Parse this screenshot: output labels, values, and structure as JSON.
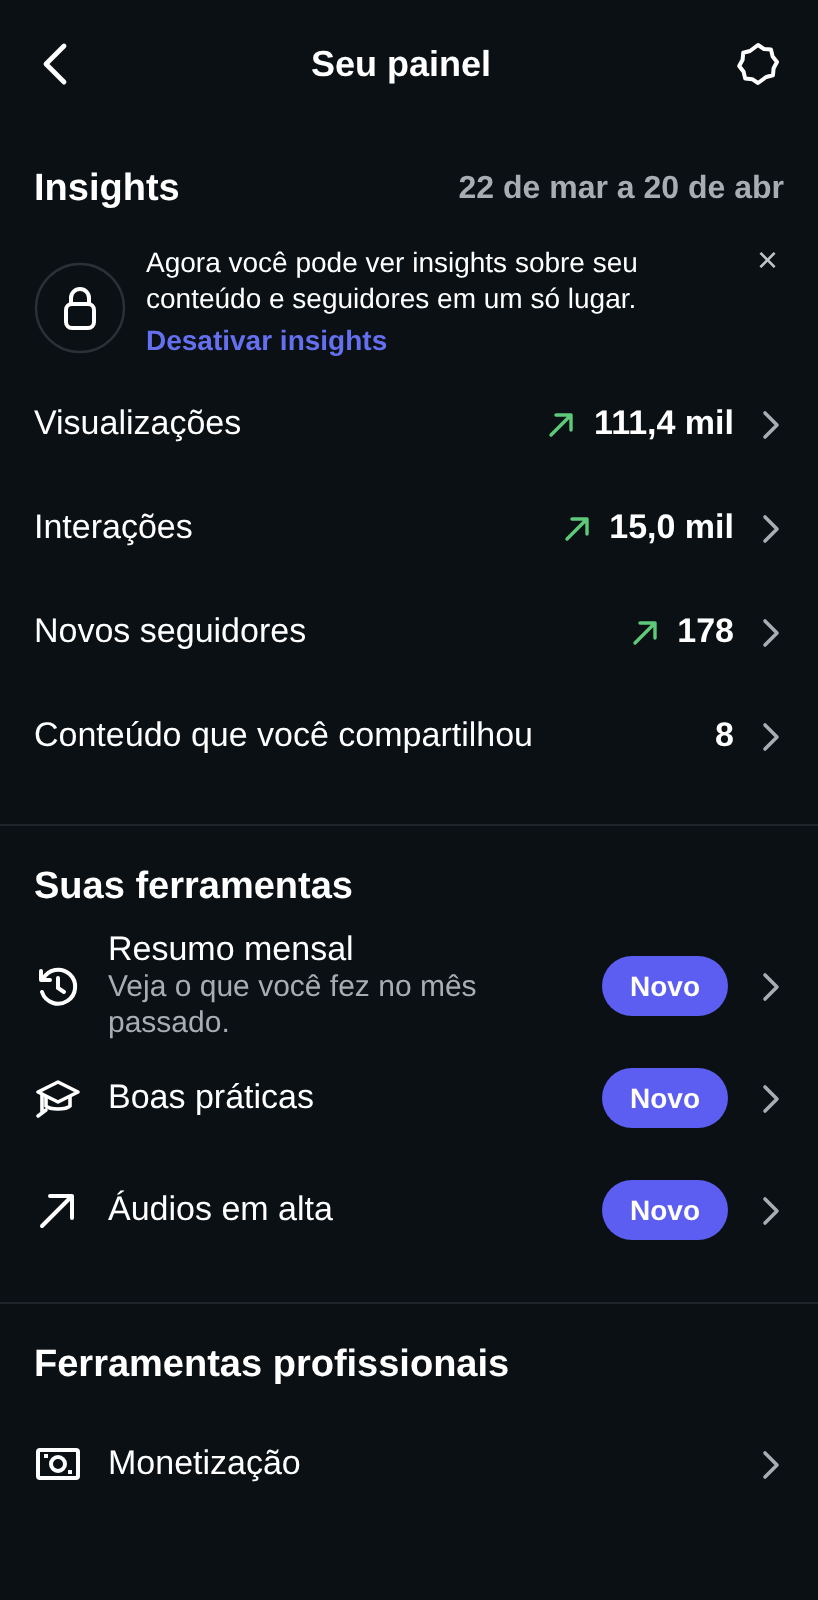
{
  "header": {
    "title": "Seu painel"
  },
  "insights": {
    "title": "Insights",
    "date_range": "22 de mar a 20 de abr",
    "banner": {
      "text": "Agora você pode ver insights sobre seu conteúdo e seguidores em um só lugar.",
      "link": "Desativar insights",
      "close": "×"
    },
    "metrics": [
      {
        "label": "Visualizações",
        "value": "111,4 mil",
        "trending": true
      },
      {
        "label": "Interações",
        "value": "15,0 mil",
        "trending": true
      },
      {
        "label": "Novos seguidores",
        "value": "178",
        "trending": true
      },
      {
        "label": "Conteúdo que você compartilhou",
        "value": "8",
        "trending": false
      }
    ]
  },
  "tools": {
    "title": "Suas ferramentas",
    "items": [
      {
        "kind": "history",
        "label": "Resumo mensal",
        "subtitle": "Veja o que você fez no mês passado.",
        "badge": "Novo"
      },
      {
        "kind": "cap",
        "label": "Boas práticas",
        "badge": "Novo"
      },
      {
        "kind": "trend",
        "label": "Áudios em alta",
        "badge": "Novo"
      }
    ]
  },
  "pro_tools": {
    "title": "Ferramentas profissionais",
    "items": [
      {
        "kind": "money",
        "label": "Monetização"
      }
    ]
  }
}
